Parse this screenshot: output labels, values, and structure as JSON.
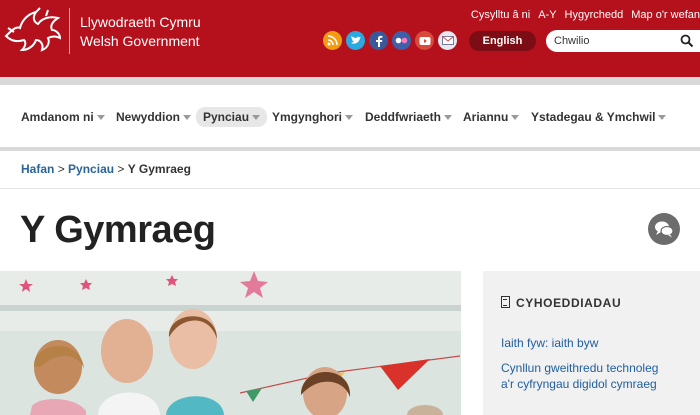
{
  "header": {
    "logo_line1": "Llywodraeth Cymru",
    "logo_line2": "Welsh Government",
    "top_links": [
      "Cysylltu â ni",
      "A-Y",
      "Hygyrchedd",
      "Map o'r wefan"
    ],
    "social_icons": [
      {
        "name": "rss-icon",
        "color": "#f39c12",
        "glyph": "◉"
      },
      {
        "name": "twitter-icon",
        "color": "#2aa9e0",
        "glyph": "t"
      },
      {
        "name": "facebook-icon",
        "color": "#3b5998",
        "glyph": "f"
      },
      {
        "name": "flickr-icon",
        "color": "#3f5fa8",
        "glyph": "●●"
      },
      {
        "name": "youtube-icon",
        "color": "#d84a3c",
        "glyph": "▶"
      },
      {
        "name": "email-icon",
        "color": "#d6474a",
        "glyph": "✉"
      }
    ],
    "language_button": "English",
    "search_placeholder": "Chwilio",
    "brand_color": "#b5111d"
  },
  "nav": {
    "items": [
      "Amdanom ni",
      "Newyddion",
      "Pynciau",
      "Ymgynghori",
      "Deddfwriaeth",
      "Ariannu",
      "Ystadegau & Ymchwil"
    ],
    "active": "Pynciau"
  },
  "breadcrumb": {
    "home": "Hafan",
    "sep1": ">",
    "section": "Pynciau",
    "sep2": ">",
    "current": "Y Gymraeg"
  },
  "page": {
    "title": "Y Gymraeg"
  },
  "sidebar": {
    "heading": "CYHOEDDIADAU",
    "links": [
      {
        "line1": "Iaith fyw: iaith byw",
        "line2": ""
      },
      {
        "line1": "Cynllun gweithredu technoleg",
        "line2": "a'r cyfryngau digidol cymraeg"
      }
    ]
  }
}
